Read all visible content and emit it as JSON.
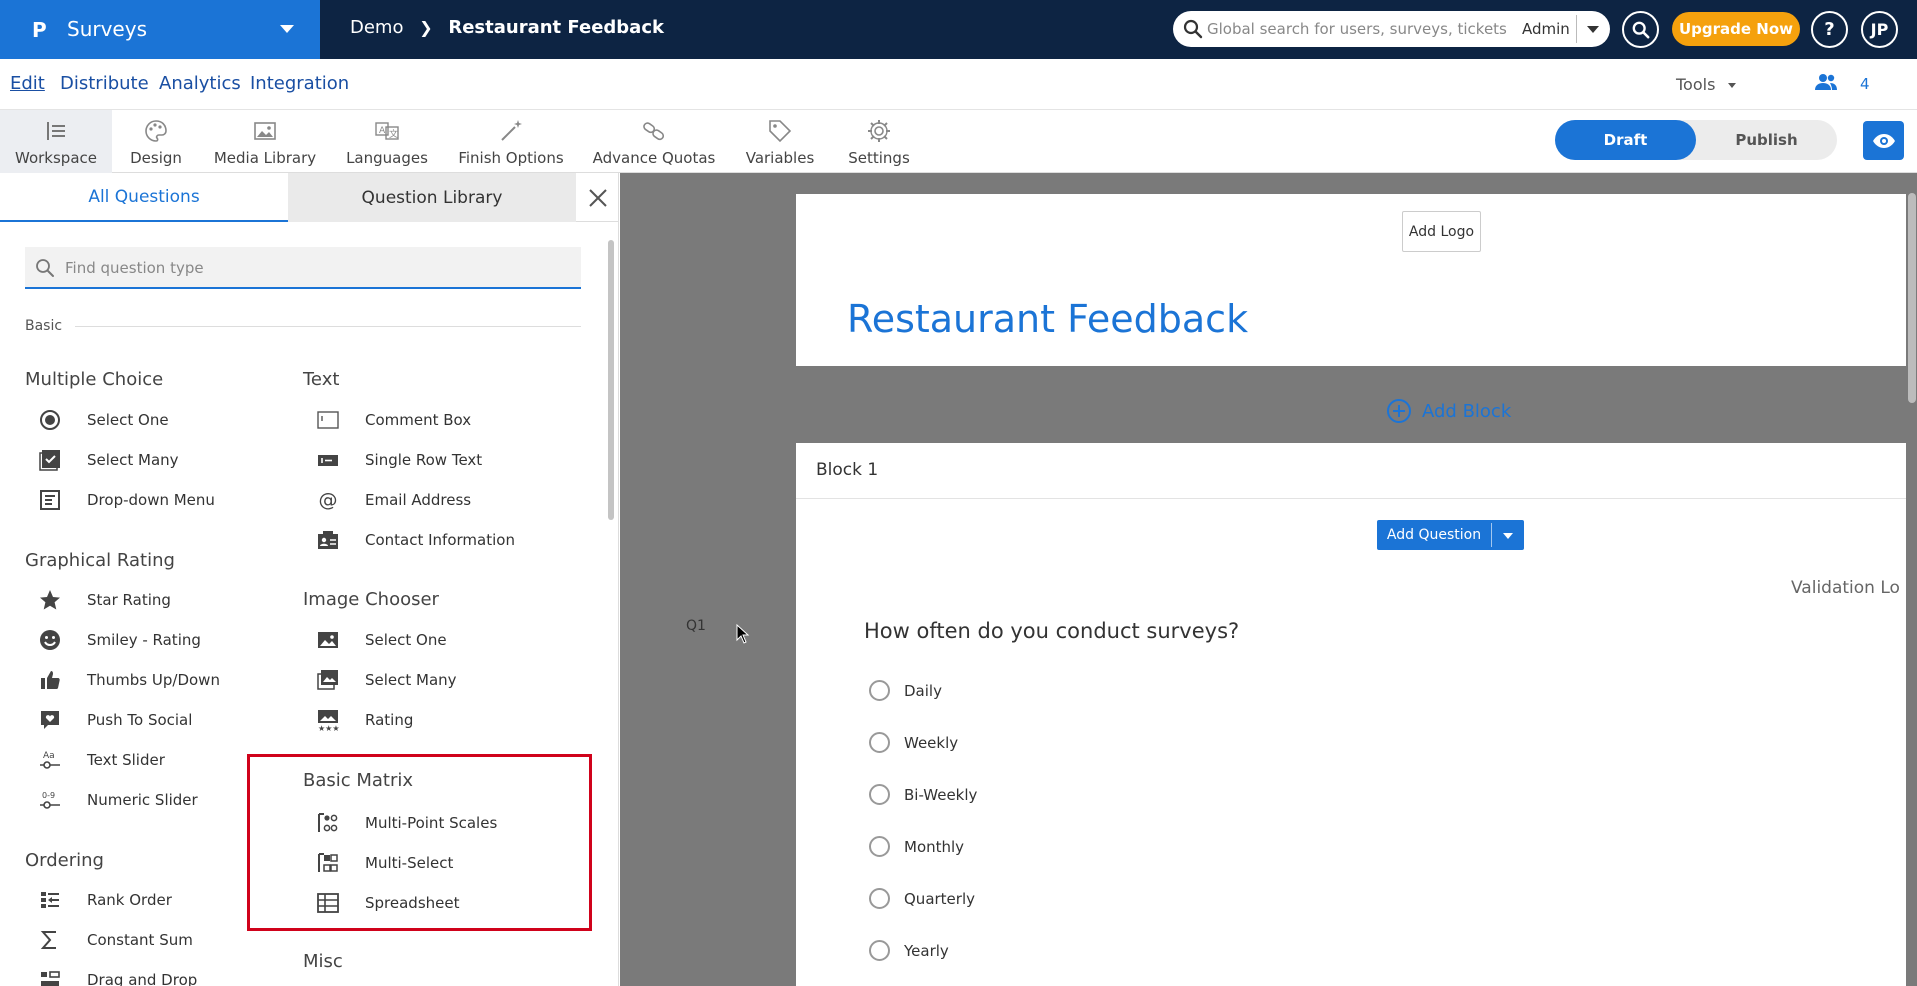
{
  "app": {
    "logo_letter": "P",
    "name": "Surveys"
  },
  "breadcrumb": {
    "parent": "Demo",
    "current": "Restaurant Feedback"
  },
  "header": {
    "search_placeholder": "Global search for users, surveys, tickets",
    "role": "Admin",
    "upgrade_label": "Upgrade Now",
    "help_label": "?",
    "avatar_initials": "JP"
  },
  "nav": {
    "items": [
      "Edit",
      "Distribute",
      "Analytics",
      "Integration"
    ],
    "tools_label": "Tools",
    "collaborators_count": "4"
  },
  "toolbar": {
    "items": [
      {
        "label": "Workspace",
        "icon": "workspace-icon"
      },
      {
        "label": "Design",
        "icon": "palette-icon"
      },
      {
        "label": "Media Library",
        "icon": "image-icon"
      },
      {
        "label": "Languages",
        "icon": "translate-icon"
      },
      {
        "label": "Finish Options",
        "icon": "magic-wand-icon"
      },
      {
        "label": "Advance Quotas",
        "icon": "link-icon"
      },
      {
        "label": "Variables",
        "icon": "tag-icon"
      },
      {
        "label": "Settings",
        "icon": "gear-icon"
      }
    ],
    "draft_label": "Draft",
    "publish_label": "Publish"
  },
  "panel": {
    "tabs": [
      "All Questions",
      "Question Library"
    ],
    "search_placeholder": "Find question type",
    "section_label": "Basic",
    "categories": {
      "multiple_choice": {
        "title": "Multiple Choice",
        "items": [
          "Select One",
          "Select Many",
          "Drop-down Menu"
        ]
      },
      "graphical_rating": {
        "title": "Graphical Rating",
        "items": [
          "Star Rating",
          "Smiley - Rating",
          "Thumbs Up/Down",
          "Push To Social",
          "Text Slider",
          "Numeric Slider"
        ]
      },
      "ordering": {
        "title": "Ordering",
        "items": [
          "Rank Order",
          "Constant Sum",
          "Drag and Drop"
        ]
      },
      "text": {
        "title": "Text",
        "items": [
          "Comment Box",
          "Single Row Text",
          "Email Address",
          "Contact Information"
        ]
      },
      "image_chooser": {
        "title": "Image Chooser",
        "items": [
          "Select One",
          "Select Many",
          "Rating"
        ]
      },
      "basic_matrix": {
        "title": "Basic Matrix",
        "items": [
          "Multi-Point Scales",
          "Multi-Select",
          "Spreadsheet"
        ]
      },
      "misc": {
        "title": "Misc"
      }
    }
  },
  "canvas": {
    "add_logo_label": "Add Logo",
    "survey_title": "Restaurant Feedback",
    "add_block_label": "Add Block",
    "block_title": "Block 1",
    "add_question_label": "Add Question",
    "question_tools": "Validation   Lo",
    "question": {
      "number": "Q1",
      "text": "How often do you conduct surveys?",
      "options": [
        "Daily",
        "Weekly",
        "Bi-Weekly",
        "Monthly",
        "Quarterly",
        "Yearly"
      ]
    }
  },
  "colors": {
    "brand_blue": "#1b74d6",
    "navy": "#0d2443",
    "upgrade_orange": "#f5a10d",
    "highlight_red": "#d0021b"
  }
}
